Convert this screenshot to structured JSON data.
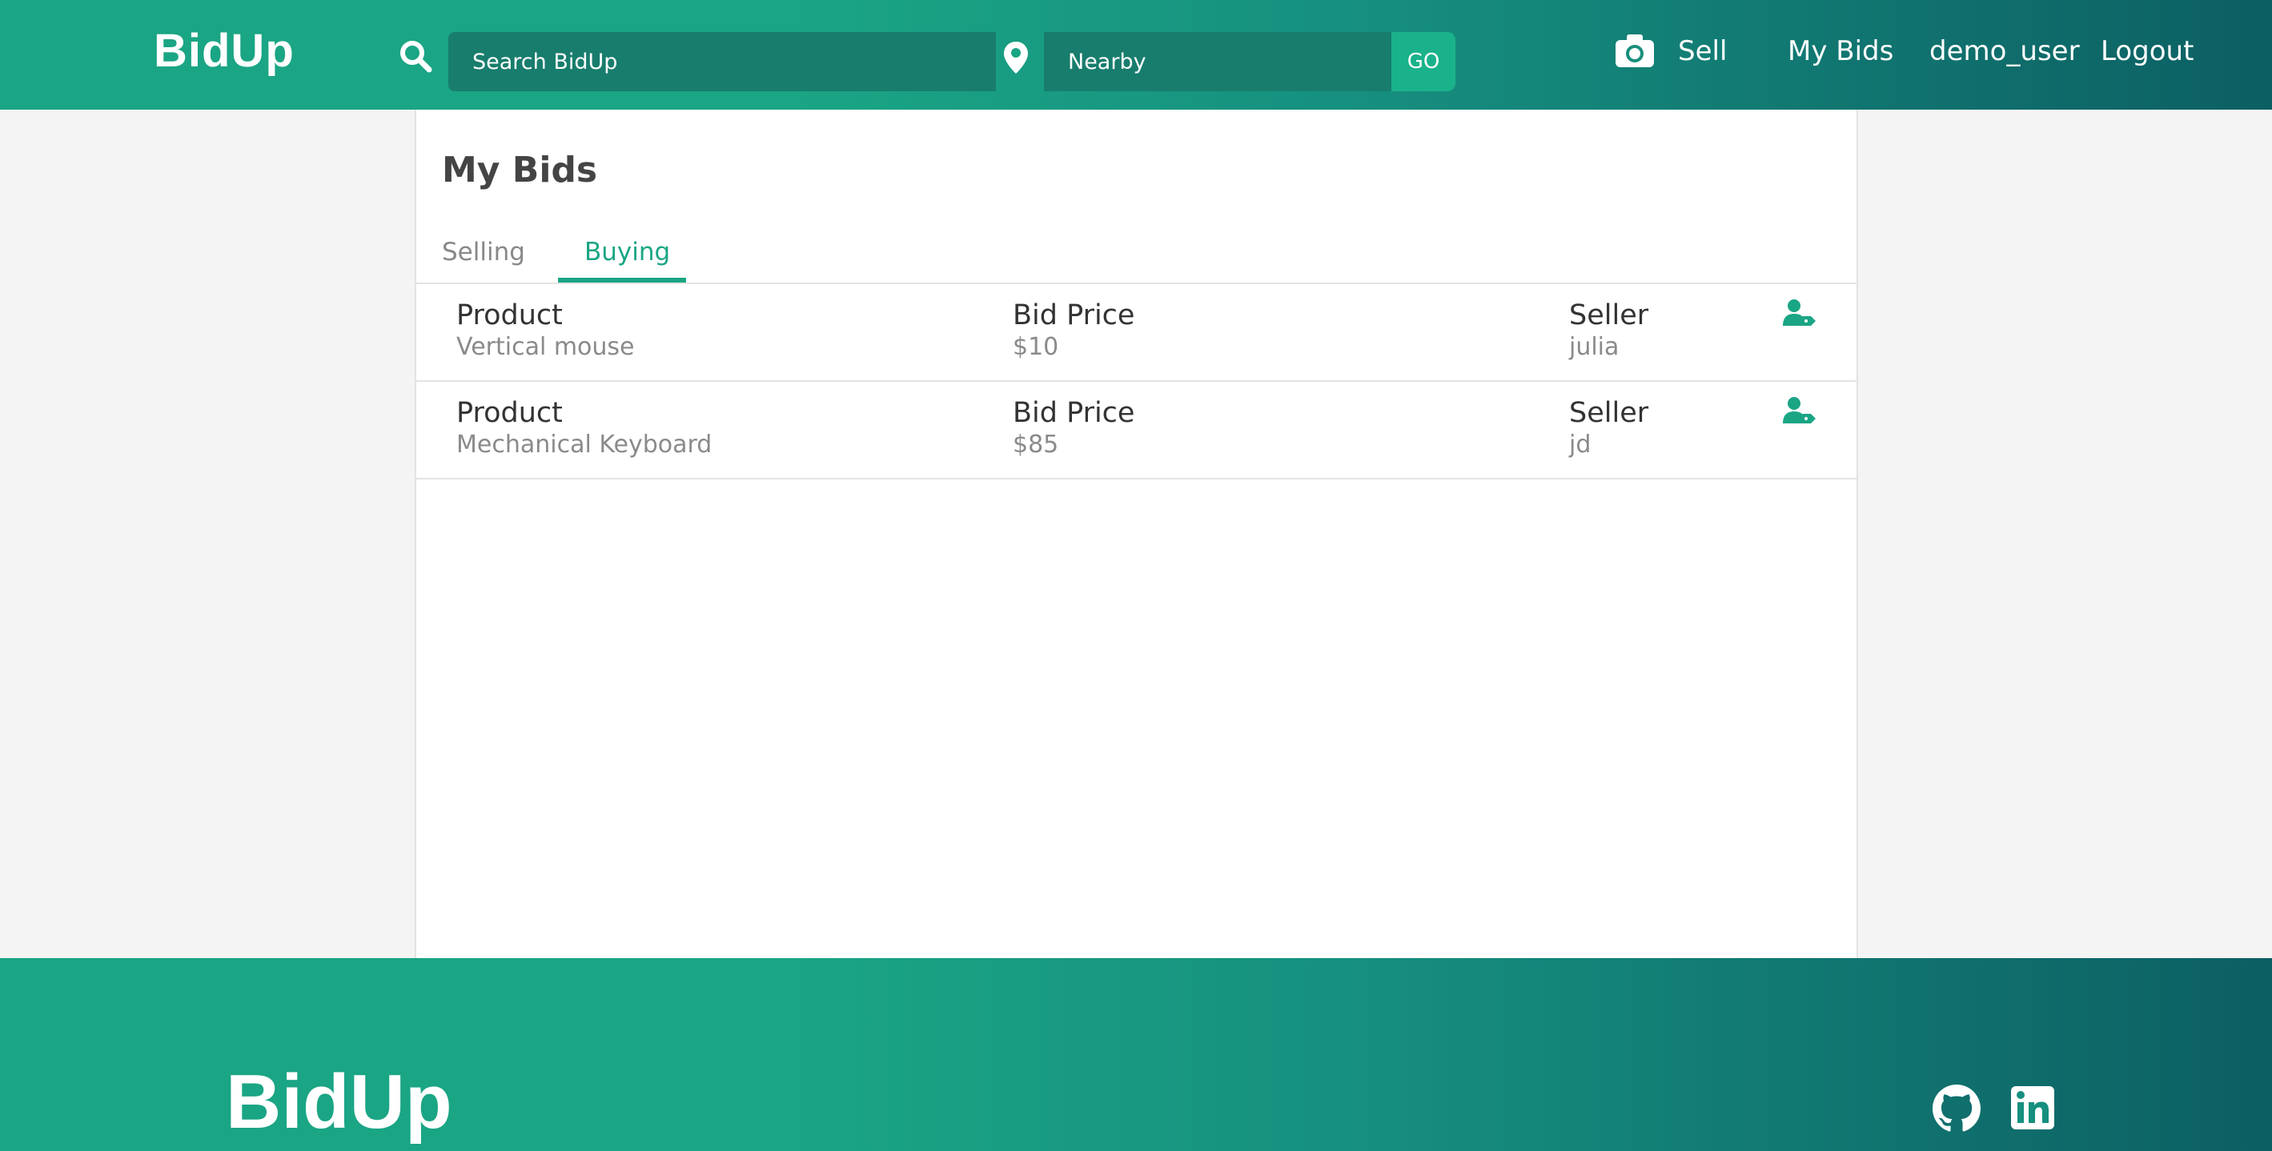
{
  "header": {
    "logo": "BidUp",
    "search": {
      "placeholder": "Search BidUp",
      "value": ""
    },
    "location": {
      "placeholder": "Nearby",
      "value": ""
    },
    "go_label": "GO",
    "nav": {
      "sell_label": "Sell",
      "my_bids_label": "My Bids",
      "username": "demo_user",
      "logout_label": "Logout"
    }
  },
  "main": {
    "title": "My Bids",
    "tabs": [
      {
        "label": "Selling",
        "active": false
      },
      {
        "label": "Buying",
        "active": true
      }
    ],
    "rows": [
      {
        "product_label": "Product",
        "product": "Vertical mouse",
        "price_label": "Bid Price",
        "price": "$10",
        "seller_label": "Seller",
        "seller": "julia",
        "icon": "user-tag-icon"
      },
      {
        "product_label": "Product",
        "product": "Mechanical Keyboard",
        "price_label": "Bid Price",
        "price": "$85",
        "seller_label": "Seller",
        "seller": "jd",
        "icon": "user-tag-icon"
      }
    ]
  },
  "footer": {
    "logo": "BidUp",
    "icons": [
      "github-icon",
      "linkedin-icon"
    ]
  },
  "colors": {
    "brand_green": "#1aa584",
    "brand_dark_teal": "#0c5f63",
    "input_bg": "#187d6d",
    "go_button_bg": "#1ab28b",
    "page_bg": "#f4f4f4"
  }
}
